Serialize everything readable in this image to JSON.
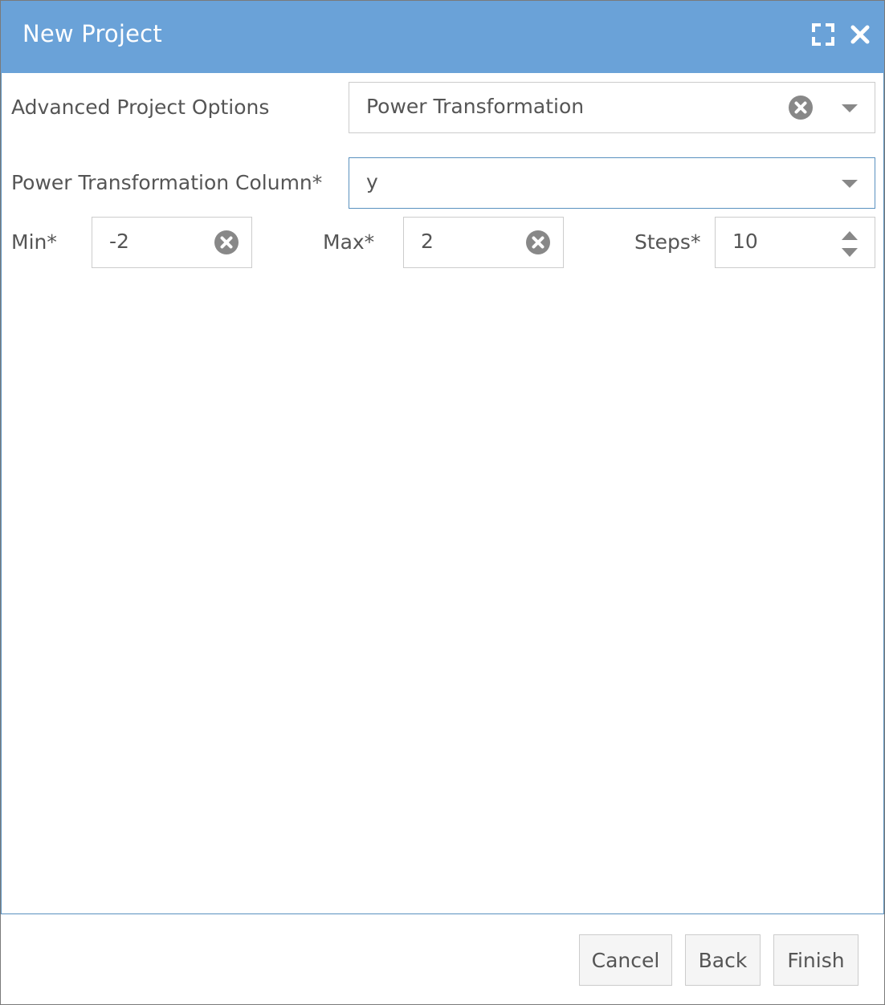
{
  "dialog": {
    "title": "New Project",
    "icons": {
      "maximize": "maximize-icon",
      "close": "close-icon"
    }
  },
  "form": {
    "advanced_options": {
      "label": "Advanced Project Options",
      "value": "Power Transformation"
    },
    "transform_column": {
      "label": "Power Transformation Column*",
      "value": "y"
    },
    "min": {
      "label": "Min*",
      "value": "-2"
    },
    "max": {
      "label": "Max*",
      "value": "2"
    },
    "steps": {
      "label": "Steps*",
      "value": "10"
    }
  },
  "footer": {
    "cancel_label": "Cancel",
    "back_label": "Back",
    "finish_label": "Finish"
  },
  "colors": {
    "titlebar": "#6aa2d8",
    "focus_border": "#5a91bf",
    "text": "#555555",
    "icon_gray": "#888888"
  }
}
